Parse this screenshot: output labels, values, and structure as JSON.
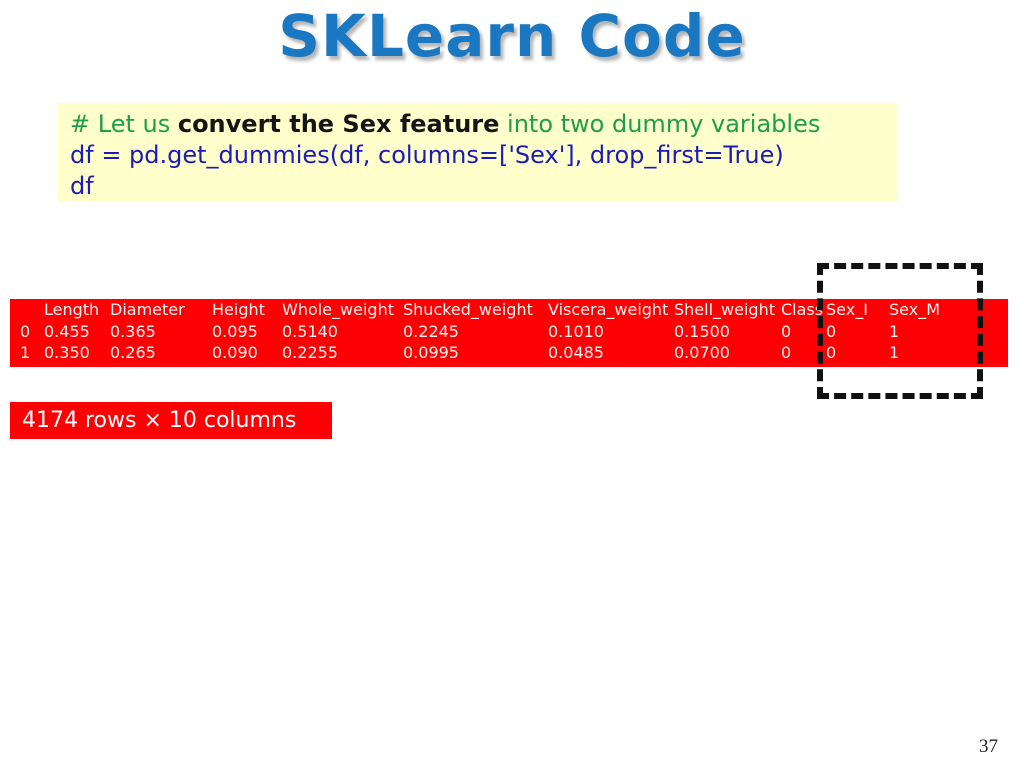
{
  "slide": {
    "title": "SKLearn Code",
    "number": "37"
  },
  "code_block": {
    "line1_comment_prefix": "# Let us ",
    "line1_comment_bold": "convert the Sex feature",
    "line1_comment_suffix": " into two dummy variables",
    "line2": "df = pd.get_dummies(df, columns=['Sex'], drop_first=True)",
    "line3": "df",
    "background_color": "#ffffcc",
    "comment_color": "#1d9e4b",
    "code_color": "#1b1bbb",
    "bold_color": "#151515"
  },
  "dataframe": {
    "accent_color": "#fc0004",
    "text_color": "#fdf2ee",
    "index_header": "",
    "columns": [
      "Length",
      "Diameter",
      "Height",
      "Whole_weight",
      "Shucked_weight",
      "Viscera_weight",
      "Shell_weight",
      "Class",
      "Sex_I",
      "Sex_M"
    ],
    "rows": [
      {
        "index": "0",
        "cells": [
          "0.455",
          "0.365",
          "0.095",
          "0.5140",
          "0.2245",
          "0.1010",
          "0.1500",
          "0",
          "0",
          "1"
        ]
      },
      {
        "index": "1",
        "cells": [
          "0.350",
          "0.265",
          "0.090",
          "0.2255",
          "0.0995",
          "0.0485",
          "0.0700",
          "0",
          "0",
          "1"
        ]
      }
    ],
    "shape_summary": "4174 rows × 10 columns"
  },
  "highlight": {
    "label": "dummy-columns-highlight",
    "border_color": "#111111",
    "style": "dashed"
  }
}
